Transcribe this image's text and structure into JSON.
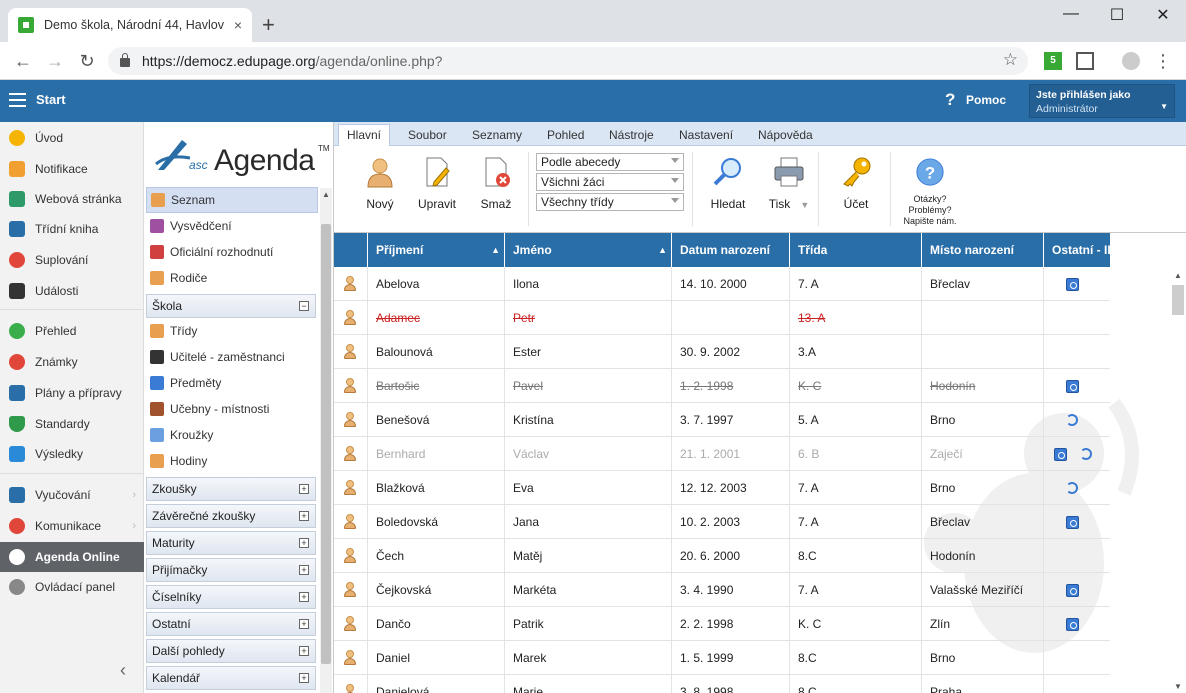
{
  "browser": {
    "tab_title": "Demo škola, Národní 44, Havlov",
    "url_host": "https://democz.edupage.org",
    "url_path": "/agenda/online.php?",
    "new_tab": "+",
    "close_tab": "×",
    "minimize": "—",
    "maximize": "☐",
    "close": "✕"
  },
  "header": {
    "start": "Start",
    "help": "Pomoc",
    "help_icon": "?",
    "user_label": "Jste přihlášen jako",
    "user_value": "Administrátor"
  },
  "leftnav": {
    "items": [
      {
        "label": "Úvod",
        "icon": "star-icon",
        "color": "#f4b400"
      },
      {
        "label": "Notifikace",
        "icon": "envelope-icon",
        "color": "#f0a030"
      },
      {
        "label": "Webová stránka",
        "icon": "home-icon",
        "color": "#2e9a6a"
      },
      {
        "label": "Třídní kniha",
        "icon": "book-icon",
        "color": "#2a6ea8"
      },
      {
        "label": "Suplování",
        "icon": "person-icon",
        "color": "#e0463a"
      },
      {
        "label": "Události",
        "icon": "calendar-icon",
        "color": "#333333"
      },
      {
        "label": "Přehled",
        "icon": "check-icon",
        "color": "#3aae4a"
      },
      {
        "label": "Známky",
        "icon": "grade-icon",
        "color": "#e0463a"
      },
      {
        "label": "Plány a přípravy",
        "icon": "briefcase-icon",
        "color": "#2a6ea8"
      },
      {
        "label": "Standardy",
        "icon": "shield-icon",
        "color": "#2e9a4a"
      },
      {
        "label": "Výsledky",
        "icon": "bar-chart-icon",
        "color": "#2a8ad8"
      },
      {
        "label": "Vyučování",
        "icon": "open-book-icon",
        "color": "#2a6ea8"
      },
      {
        "label": "Komunikace",
        "icon": "chat-icon",
        "color": "#e0463a"
      },
      {
        "label": "Agenda Online",
        "icon": "pen-icon",
        "color": "#ffffff"
      },
      {
        "label": "Ovládací panel",
        "icon": "gear-icon",
        "color": "#888888"
      }
    ],
    "collapse": "‹"
  },
  "agenda": {
    "logo_asc": "asc",
    "logo_agenda": "Agenda",
    "logo_tm": "TM",
    "list_top": [
      {
        "label": "Seznam",
        "color": "#e8a050"
      },
      {
        "label": "Vysvědčení",
        "color": "#a050a0"
      },
      {
        "label": "Oficiální rozhodnutí",
        "color": "#d04040"
      },
      {
        "label": "Rodiče",
        "color": "#e8a050"
      }
    ],
    "group_skola": "Škola",
    "group_skola_toggle": "−",
    "list_skola": [
      {
        "label": "Třídy",
        "color": "#e8a050"
      },
      {
        "label": "Učitelé - zaměstnanci",
        "color": "#333333"
      },
      {
        "label": "Předměty",
        "color": "#3a7bd5"
      },
      {
        "label": "Učebny - místnosti",
        "color": "#a0522d"
      },
      {
        "label": "Kroužky",
        "color": "#6aa0e0"
      },
      {
        "label": "Hodiny",
        "color": "#e8a050"
      }
    ],
    "groups": [
      {
        "label": "Zkoušky",
        "toggle": "+"
      },
      {
        "label": "Závěrečné zkoušky",
        "toggle": "+"
      },
      {
        "label": "Maturity",
        "toggle": "+"
      },
      {
        "label": "Přijímačky",
        "toggle": "+"
      },
      {
        "label": "Číselníky",
        "toggle": "+"
      },
      {
        "label": "Ostatní",
        "toggle": "+"
      },
      {
        "label": "Další pohledy",
        "toggle": "+"
      },
      {
        "label": "Kalendář",
        "toggle": "+"
      }
    ]
  },
  "menu": {
    "tabs": [
      "Hlavní",
      "Soubor",
      "Seznamy",
      "Pohled",
      "Nástroje",
      "Nastavení",
      "Nápověda"
    ]
  },
  "ribbon": {
    "new": "Nový",
    "edit": "Upravit",
    "delete": "Smaž",
    "sort_select": "Podle abecedy",
    "students_select": "Všichni žáci",
    "classes_select": "Všechny třídy",
    "search": "Hledat",
    "print": "Tisk",
    "account": "Účet",
    "help_line1": "Otázky?",
    "help_line2": "Problémy?",
    "help_line3": "Napište nám."
  },
  "grid": {
    "columns": [
      "Příjmení",
      "Jméno",
      "Datum narození",
      "Třída",
      "Místo narození",
      "Ostatní - II"
    ],
    "sort_icon": "▲",
    "rows": [
      {
        "surname": "Abelova",
        "name": "Ilona",
        "born": "14. 10. 2000",
        "class": "7. A",
        "place": "Břeclav",
        "other": "doc",
        "state": "normal"
      },
      {
        "surname": "Adamec",
        "name": "Petr",
        "born": "",
        "class": "13. A",
        "place": "",
        "other": "",
        "state": "deleted"
      },
      {
        "surname": "Balounová",
        "name": "Ester",
        "born": "30. 9. 2002",
        "class": "3.A",
        "place": "",
        "other": "",
        "state": "normal"
      },
      {
        "surname": "Bartošic",
        "name": "Pavel",
        "born": "1. 2. 1998",
        "class": "K. C",
        "place": "Hodonín",
        "other": "doc",
        "state": "struck"
      },
      {
        "surname": "Benešová",
        "name": "Kristína",
        "born": "3. 7. 1997",
        "class": "5. A",
        "place": "Brno",
        "other": "ref",
        "state": "normal"
      },
      {
        "surname": "Bernhard",
        "name": "Václav",
        "born": "21. 1. 2001",
        "class": "6. B",
        "place": "Zaječí",
        "other": "doc-ref",
        "state": "gray"
      },
      {
        "surname": "Blažková",
        "name": "Eva",
        "born": "12. 12. 2003",
        "class": "7. A",
        "place": "Brno",
        "other": "ref",
        "state": "normal"
      },
      {
        "surname": "Boledovská",
        "name": "Jana",
        "born": "10. 2. 2003",
        "class": "7. A",
        "place": "Břeclav",
        "other": "doc",
        "state": "normal"
      },
      {
        "surname": "Čech",
        "name": "Matěj",
        "born": "20. 6. 2000",
        "class": "8.C",
        "place": "Hodonín",
        "other": "",
        "state": "normal"
      },
      {
        "surname": "Čejkovská",
        "name": "Markéta",
        "born": "3. 4. 1990",
        "class": "7. A",
        "place": "Valašské Meziříčí",
        "other": "doc",
        "state": "normal"
      },
      {
        "surname": "Dančo",
        "name": "Patrik",
        "born": "2. 2. 1998",
        "class": "K. C",
        "place": "Zlín",
        "other": "doc",
        "state": "normal"
      },
      {
        "surname": "Daniel",
        "name": "Marek",
        "born": "1. 5. 1999",
        "class": "8.C",
        "place": "Brno",
        "other": "",
        "state": "normal"
      },
      {
        "surname": "Danielová",
        "name": "Marie",
        "born": "3. 8. 1998",
        "class": "8.C",
        "place": "Praha",
        "other": "",
        "state": "normal"
      }
    ]
  }
}
